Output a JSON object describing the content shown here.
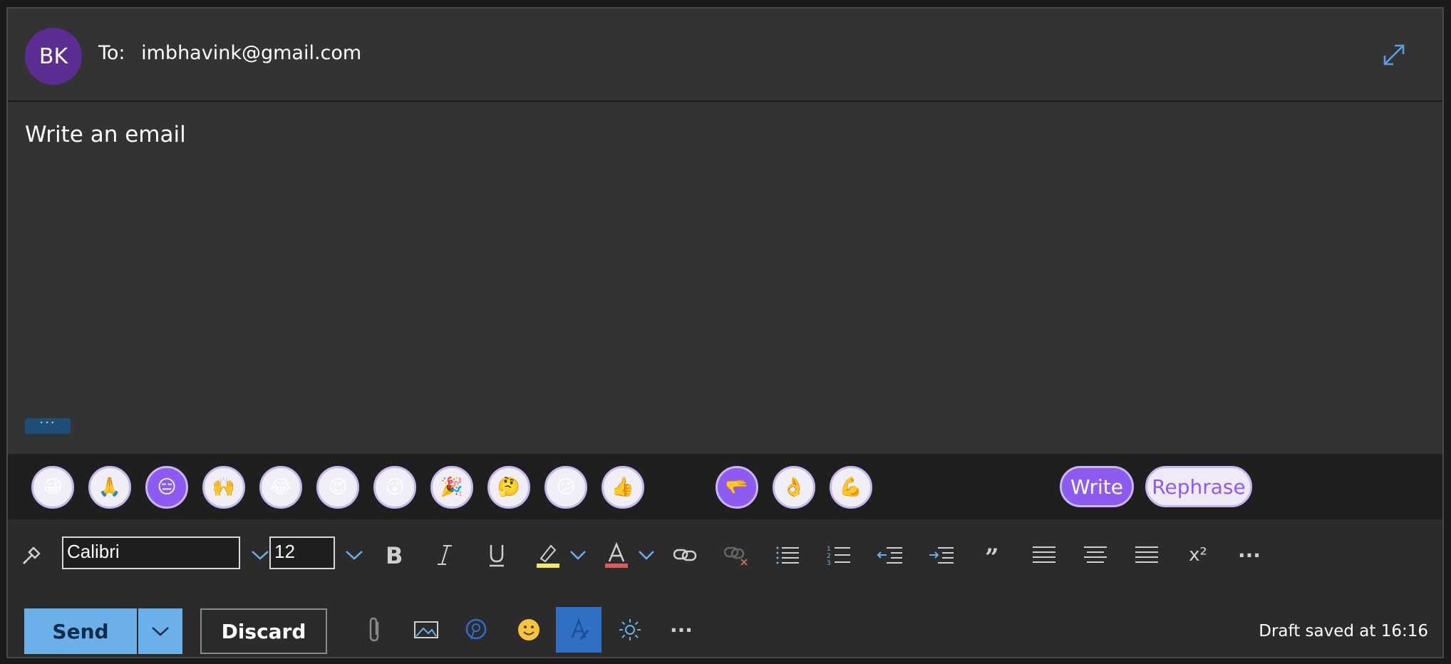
{
  "header": {
    "avatar_initials": "BK",
    "to_label": "To:",
    "to_address": "imbhavink@gmail.com"
  },
  "body": {
    "placeholder_text": "Write an email",
    "more_label": "···"
  },
  "suggestions": {
    "emojis": [
      "😀",
      "🙏",
      "😑",
      "🙌",
      "😂",
      "😍",
      "😮",
      "🎉",
      "🤔",
      "😕",
      "👍"
    ],
    "selected_emoji_index": 2,
    "gestures": [
      "🫳",
      "👌",
      "💪"
    ],
    "selected_gesture_index": 0,
    "write_label": "Write",
    "rephrase_label": "Rephrase"
  },
  "format": {
    "font_name": "Calibri",
    "font_size": "12",
    "superscript_label": "x²",
    "more_label": "···"
  },
  "actions": {
    "send_label": "Send",
    "discard_label": "Discard",
    "more_label": "···",
    "draft_status": "Draft saved at 16:16"
  },
  "colors": {
    "accent_purple": "#8e5bf0",
    "send_blue": "#6cb0ea",
    "avatar_purple": "#5c2d91",
    "highlight_yellow": "#f5e663",
    "font_color_red": "#e05a5a"
  }
}
